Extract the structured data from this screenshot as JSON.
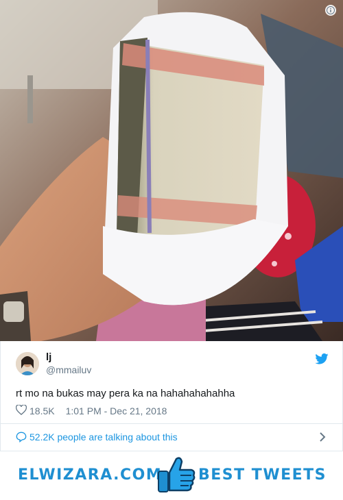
{
  "photo": {
    "description_icon": "info-icon"
  },
  "tweet": {
    "display_name": "lj",
    "handle": "@mmailuv",
    "text": "rt mo na bukas may pera ka na hahahahahahha",
    "likes": "18.5K",
    "timestamp": "1:01 PM - Dec 21, 2018",
    "talking": "52.2K people are talking about this"
  },
  "banner": {
    "site": "ELWIZARA.COM",
    "tagline": "BEST TWEETS"
  },
  "colors": {
    "accent": "#1b95e0",
    "brand": "#1f8fd1",
    "text": "#14171a",
    "muted": "#657786"
  }
}
